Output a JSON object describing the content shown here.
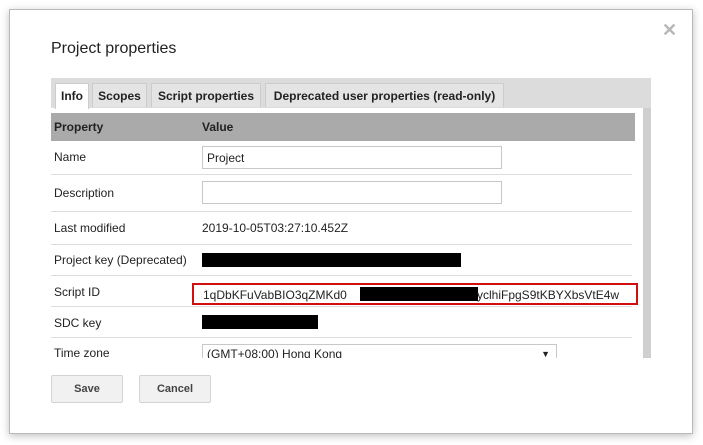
{
  "dialog": {
    "title": "Project properties",
    "close_icon": "close-icon"
  },
  "tabs": [
    {
      "label": "Info",
      "active": true
    },
    {
      "label": "Scopes",
      "active": false
    },
    {
      "label": "Script properties",
      "active": false
    },
    {
      "label": "Deprecated user properties (read-only)",
      "active": false
    }
  ],
  "table": {
    "headers": {
      "property": "Property",
      "value": "Value"
    },
    "rows": {
      "name": {
        "label": "Name",
        "value": "Project"
      },
      "description": {
        "label": "Description",
        "value": ""
      },
      "last_modified": {
        "label": "Last modified",
        "value": "2019-10-05T03:27:10.452Z"
      },
      "project_key": {
        "label": "Project key (Deprecated)",
        "value_redacted": true
      },
      "script_id": {
        "label": "Script ID",
        "value_prefix": "1qDbKFuVabBIO3qZMKd0",
        "value_suffix": "yclhiFpgS9tKBYXbsVtE4w",
        "highlight_color": "#d20f0f"
      },
      "sdc_key": {
        "label": "SDC key",
        "value_redacted": true
      },
      "time_zone": {
        "label": "Time zone",
        "value": "(GMT+08:00) Hong Kong"
      }
    }
  },
  "buttons": {
    "save": "Save",
    "cancel": "Cancel"
  }
}
